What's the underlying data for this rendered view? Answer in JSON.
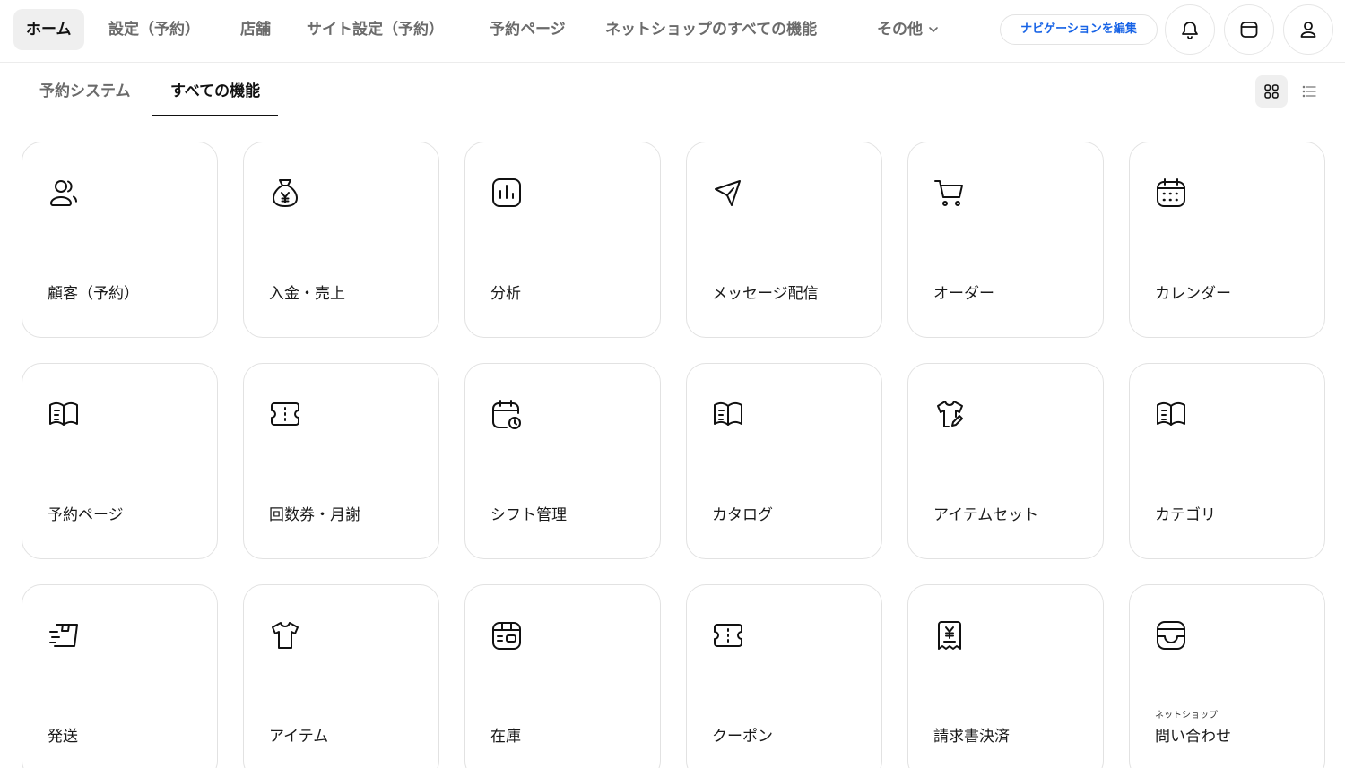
{
  "nav": {
    "items": [
      {
        "label": "ホーム",
        "active": true
      },
      {
        "label": "設定（予約）"
      },
      {
        "label": "店舗"
      },
      {
        "label": "サイト設定（予約）"
      },
      {
        "label": "予約ページ"
      },
      {
        "label": "ネットショップのすべての機能"
      }
    ],
    "more_label": "その他",
    "edit_label": "ナビゲーションを編集",
    "icons": [
      "bell-icon",
      "browser-window-icon",
      "user-icon"
    ]
  },
  "tabs": [
    {
      "label": "予約システム"
    },
    {
      "label": "すべての機能",
      "active": true
    }
  ],
  "view_toggle": {
    "active": "grid",
    "options": [
      "grid-view-icon",
      "list-view-icon"
    ]
  },
  "features": [
    {
      "label": "顧客（予約）",
      "icon": "customers-icon"
    },
    {
      "label": "入金・売上",
      "icon": "money-bag-icon"
    },
    {
      "label": "分析",
      "icon": "analytics-chart-icon"
    },
    {
      "label": "メッセージ配信",
      "icon": "paper-plane-icon"
    },
    {
      "label": "オーダー",
      "icon": "shopping-cart-icon"
    },
    {
      "label": "カレンダー",
      "icon": "calendar-icon"
    },
    {
      "label": "予約ページ",
      "icon": "open-book-icon"
    },
    {
      "label": "回数券・月謝",
      "icon": "ticket-icon"
    },
    {
      "label": "シフト管理",
      "icon": "calendar-clock-icon"
    },
    {
      "label": "カタログ",
      "icon": "open-book-icon"
    },
    {
      "label": "アイテムセット",
      "icon": "shirt-edit-icon"
    },
    {
      "label": "カテゴリ",
      "icon": "open-book-icon"
    },
    {
      "label": "発送",
      "icon": "shipping-box-icon"
    },
    {
      "label": "アイテム",
      "icon": "shirt-icon"
    },
    {
      "label": "在庫",
      "icon": "inventory-box-icon"
    },
    {
      "label": "クーポン",
      "icon": "coupon-icon"
    },
    {
      "label": "請求書決済",
      "icon": "invoice-yen-icon"
    },
    {
      "label": "問い合わせ",
      "sublabel": "ネットショップ",
      "icon": "inbox-icon"
    }
  ],
  "colors": {
    "accent_link": "#1763e6",
    "border": "#e2e2e2",
    "active_bg": "#efefef"
  }
}
